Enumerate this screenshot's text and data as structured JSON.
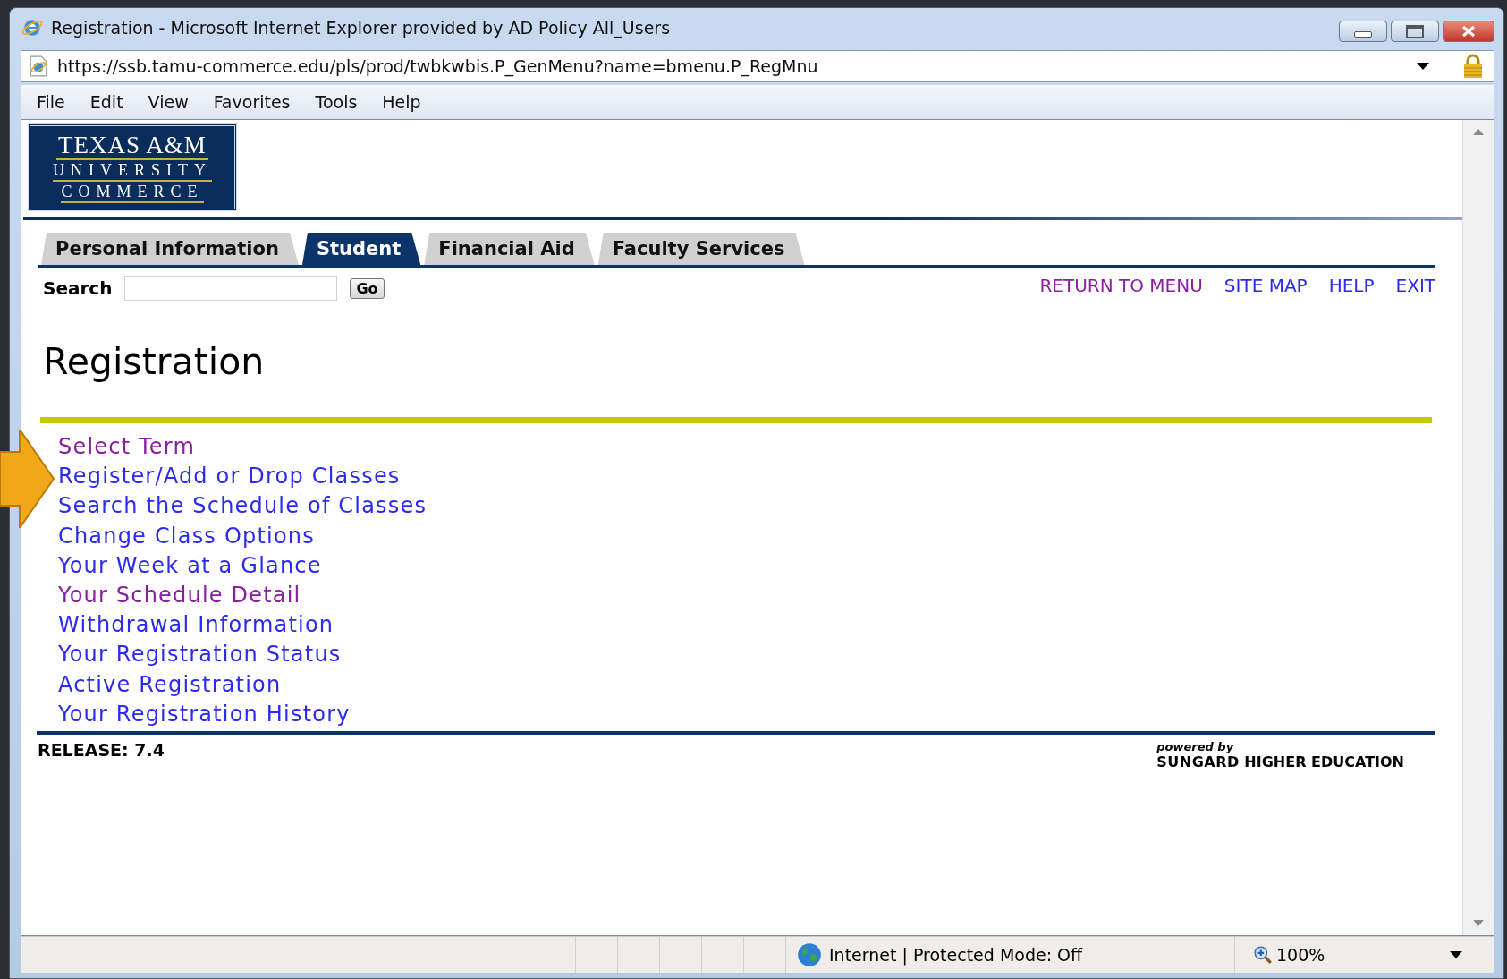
{
  "window": {
    "title": "Registration - Microsoft Internet Explorer provided by AD Policy All_Users"
  },
  "address_bar": {
    "value": "https://ssb.tamu-commerce.edu/pls/prod/twbkwbis.P_GenMenu?name=bmenu.P_RegMnu"
  },
  "menu_bar": [
    "File",
    "Edit",
    "View",
    "Favorites",
    "Tools",
    "Help"
  ],
  "logo": {
    "lines": [
      "TEXAS A&M",
      "UNIVERSITY",
      "COMMERCE"
    ]
  },
  "tabs": [
    {
      "label": "Personal Information",
      "selected": false
    },
    {
      "label": "Student",
      "selected": true
    },
    {
      "label": "Financial Aid",
      "selected": false
    },
    {
      "label": "Faculty Services",
      "selected": false
    }
  ],
  "search": {
    "label": "Search",
    "button": "Go"
  },
  "top_links": [
    {
      "label": "RETURN TO MENU",
      "visited": true
    },
    {
      "label": "SITE MAP",
      "visited": false
    },
    {
      "label": "HELP",
      "visited": false
    },
    {
      "label": "EXIT",
      "visited": false
    }
  ],
  "heading": "Registration",
  "links": [
    {
      "label": "Select Term",
      "visited": true
    },
    {
      "label": "Register/Add or Drop Classes",
      "visited": false
    },
    {
      "label": "Search the Schedule of Classes",
      "visited": false
    },
    {
      "label": "Change Class Options",
      "visited": false
    },
    {
      "label": "Your Week at a Glance",
      "visited": false
    },
    {
      "label": "Your Schedule Detail",
      "visited": true
    },
    {
      "label": "Withdrawal Information",
      "visited": false
    },
    {
      "label": "Your Registration Status",
      "visited": false
    },
    {
      "label": "Active Registration",
      "visited": false
    },
    {
      "label": "Your Registration History",
      "visited": false
    }
  ],
  "release": "RELEASE: 7.4",
  "powered_by": {
    "caption": "powered by",
    "brand": "SUNGARD",
    "suffix": "HIGHER EDUCATION"
  },
  "status_bar": {
    "zone": "Internet | Protected Mode: Off",
    "zoom": "100%"
  }
}
